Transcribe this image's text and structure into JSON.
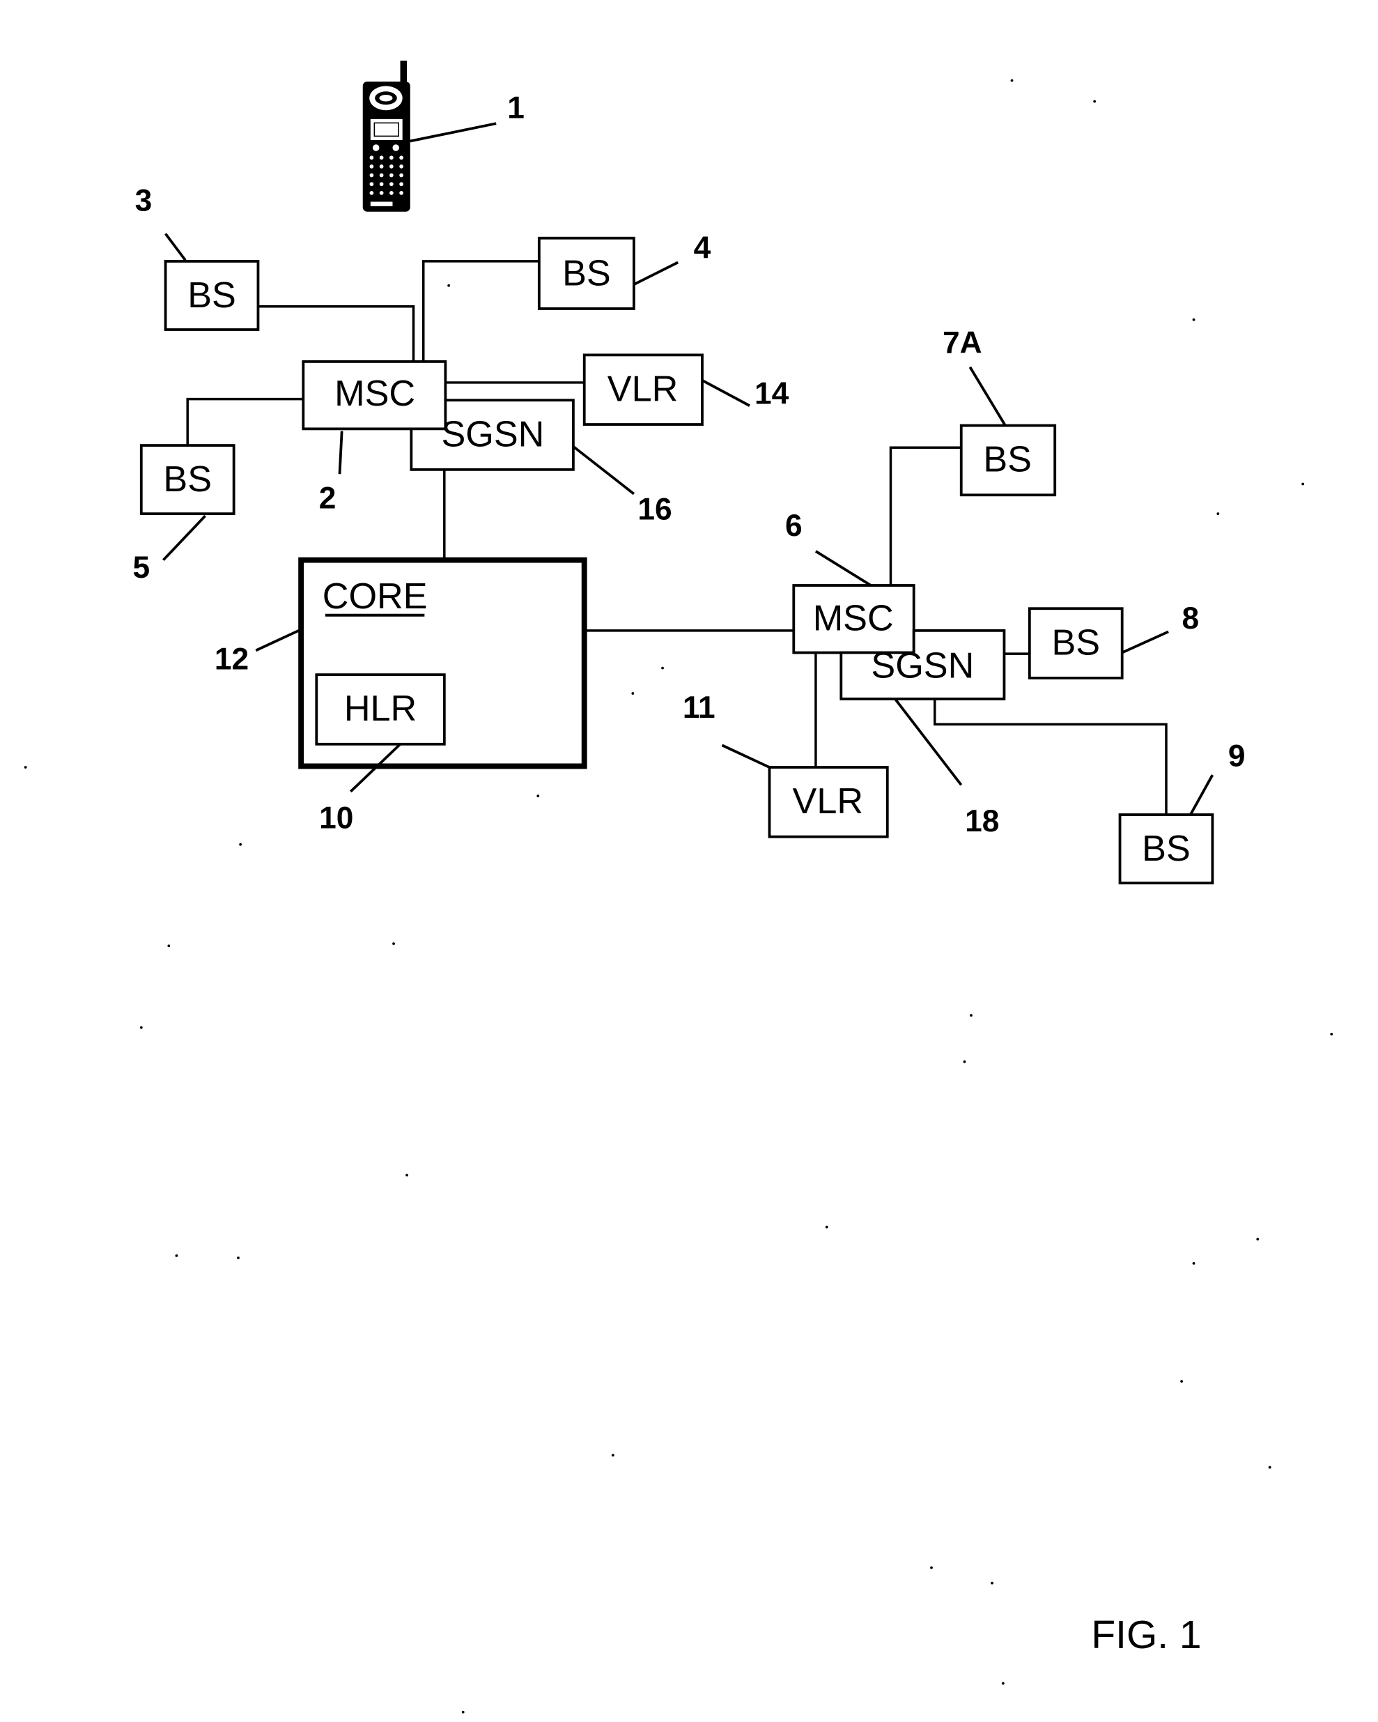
{
  "figure": {
    "caption": "FIG. 1",
    "core": {
      "label": "CORE",
      "ref": "12"
    },
    "nodes": {
      "phone": {
        "ref": "1",
        "icon": "mobile-phone-icon"
      },
      "msc_2": {
        "label": "MSC",
        "ref": "2"
      },
      "bs_3": {
        "label": "BS",
        "ref": "3"
      },
      "bs_4": {
        "label": "BS",
        "ref": "4"
      },
      "bs_5": {
        "label": "BS",
        "ref": "5"
      },
      "msc_6": {
        "label": "MSC",
        "ref": "6"
      },
      "bs_7a": {
        "label": "BS",
        "ref": "7A"
      },
      "bs_8": {
        "label": "BS",
        "ref": "8"
      },
      "bs_9": {
        "label": "BS",
        "ref": "9"
      },
      "hlr_10": {
        "label": "HLR",
        "ref": "10"
      },
      "vlr_11": {
        "label": "VLR",
        "ref": "11"
      },
      "vlr_14": {
        "label": "VLR",
        "ref": "14"
      },
      "sgsn_16": {
        "label": "SGSN",
        "ref": "16"
      },
      "sgsn_18": {
        "label": "SGSN",
        "ref": "18"
      }
    },
    "connections": [
      [
        "bs_3",
        "msc_2"
      ],
      [
        "bs_4",
        "msc_2"
      ],
      [
        "bs_5",
        "msc_2"
      ],
      [
        "msc_2",
        "vlr_14"
      ],
      [
        "msc_2",
        "sgsn_16"
      ],
      [
        "sgsn_16",
        "core"
      ],
      [
        "core",
        "msc_6"
      ],
      [
        "msc_6",
        "bs_7a"
      ],
      [
        "msc_6",
        "vlr_11"
      ],
      [
        "msc_6",
        "sgsn_18"
      ],
      [
        "sgsn_18",
        "bs_8"
      ],
      [
        "sgsn_18",
        "bs_9"
      ]
    ]
  }
}
